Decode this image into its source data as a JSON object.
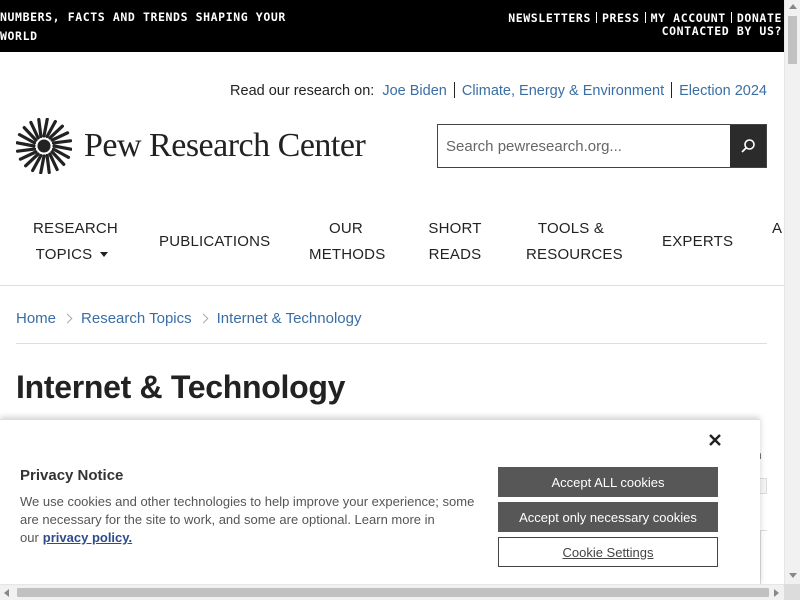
{
  "topbar": {
    "tagline": "NUMBERS, FACTS AND TRENDS SHAPING YOUR WORLD",
    "links": [
      "NEWSLETTERS",
      "PRESS",
      "MY ACCOUNT",
      "DONATE"
    ],
    "contact": "CONTACTED BY US?"
  },
  "research_on": {
    "lead": "Read our research on:",
    "topics": [
      "Joe Biden",
      "Climate, Energy & Environment",
      "Election 2024"
    ]
  },
  "logo": {
    "text": "Pew Research Center",
    "icon": "pew-sunburst-logo"
  },
  "search": {
    "placeholder": "Search pewresearch.org...",
    "icon": "search-icon"
  },
  "nav": {
    "items": [
      {
        "line1": "RESEARCH",
        "line2": "TOPICS"
      },
      {
        "line1": "PUBLICATIONS",
        "line2": ""
      },
      {
        "line1": "OUR",
        "line2": "METHODS"
      },
      {
        "line1": "SHORT",
        "line2": "READS"
      },
      {
        "line1": "TOOLS &",
        "line2": "RESOURCES"
      },
      {
        "line1": "EXPERTS",
        "line2": ""
      },
      {
        "line1": "A",
        "line2": ""
      }
    ]
  },
  "breadcrumb": [
    "Home",
    "Research Topics",
    "Internet & Technology"
  ],
  "page": {
    "title": "Internet & Technology",
    "peek_text": "n"
  },
  "cookie": {
    "title": "Privacy Notice",
    "body": "We use cookies and other technologies to help improve your experience; some are necessary for the site to work, and some are optional. Learn more in our",
    "link": "privacy policy.",
    "accept_all": "Accept ALL cookies",
    "accept_necessary": "Accept only necessary cookies",
    "settings": "Cookie Settings",
    "close_icon": "close-icon"
  },
  "colors": {
    "link": "#3a6ea5",
    "topbar": "#000000",
    "button": "#575757"
  }
}
